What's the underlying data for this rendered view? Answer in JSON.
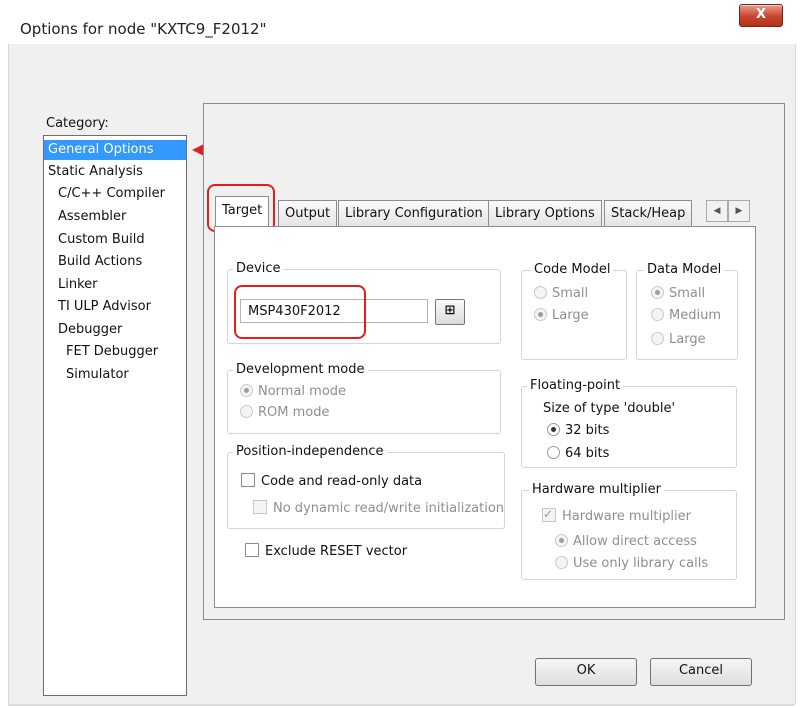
{
  "window": {
    "title": "Options for node \"KXTC9_F2012\"",
    "close_label": "X"
  },
  "category": {
    "label": "Category:",
    "items": [
      {
        "label": "General Options"
      },
      {
        "label": "Static Analysis"
      },
      {
        "label": "C/C++ Compiler"
      },
      {
        "label": "Assembler"
      },
      {
        "label": "Custom Build"
      },
      {
        "label": "Build Actions"
      },
      {
        "label": "Linker"
      },
      {
        "label": "TI ULP Advisor"
      },
      {
        "label": "Debugger"
      },
      {
        "label": "FET Debugger"
      },
      {
        "label": "Simulator"
      }
    ],
    "selected": "General Options"
  },
  "tabs": [
    {
      "label": "Target"
    },
    {
      "label": "Output"
    },
    {
      "label": "Library Configuration"
    },
    {
      "label": "Library Options"
    },
    {
      "label": "Stack/Heap"
    }
  ],
  "active_tab": "Target",
  "device": {
    "label": "Device",
    "value": "MSP430F2012"
  },
  "code_model": {
    "label": "Code Model",
    "options": [
      "Small",
      "Large"
    ],
    "selected": "Large"
  },
  "data_model": {
    "label": "Data Model",
    "options": [
      "Small",
      "Medium",
      "Large"
    ],
    "selected": "Small"
  },
  "dev_mode": {
    "label": "Development mode",
    "options": [
      "Normal mode",
      "ROM mode"
    ],
    "selected": "Normal mode"
  },
  "floating": {
    "label": "Floating-point",
    "sublabel": "Size of type 'double'",
    "options": [
      "32 bits",
      "64 bits"
    ],
    "selected": "32 bits"
  },
  "position": {
    "label": "Position-independence",
    "code_readonly": "Code and read-only data",
    "no_dynamic": "No dynamic read/write initialization"
  },
  "hw_mult": {
    "label": "Hardware multiplier",
    "checkbox": "Hardware multiplier",
    "checked": true,
    "options": [
      "Allow direct access",
      "Use only library calls"
    ],
    "selected": "Allow direct access"
  },
  "exclude_reset": "Exclude RESET vector",
  "buttons": {
    "ok": "OK",
    "cancel": "Cancel"
  },
  "colors": {
    "selection": "#3399ff",
    "annotation": "#e02020",
    "dialog_bg": "#f0f0f0"
  }
}
